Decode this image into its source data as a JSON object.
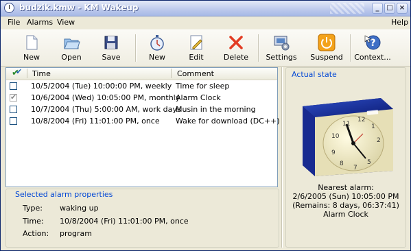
{
  "window": {
    "title": "budzik.kmw - KM Wakeup"
  },
  "menu": {
    "file": "File",
    "alarms": "Alarms",
    "view": "View",
    "help": "Help"
  },
  "toolbar": {
    "new1": "New",
    "open": "Open",
    "save": "Save",
    "new2": "New",
    "edit": "Edit",
    "delete": "Delete",
    "settings": "Settings",
    "suspend": "Suspend",
    "context": "Context..."
  },
  "list": {
    "col_time": "Time",
    "col_comment": "Comment",
    "rows": [
      {
        "time": "10/5/2004 (Tue) 10:00:00 PM, weekly",
        "comment": "Time for sleep"
      },
      {
        "time": "10/6/2004 (Wed) 10:05:00 PM, monthly",
        "comment": "Alarm Clock"
      },
      {
        "time": "10/7/2004 (Thu) 5:00:00 AM, work days",
        "comment": "Musin in the morning"
      },
      {
        "time": "10/8/2004 (Fri) 11:01:00 PM, once",
        "comment": "Wake for download (DC++)"
      }
    ]
  },
  "props": {
    "title": "Selected alarm properties",
    "type_label": "Type:",
    "type_value": "waking up",
    "time_label": "Time:",
    "time_value": "10/8/2004 (Fri) 11:01:00 PM, once",
    "action_label": "Action:",
    "action_value": "program"
  },
  "state": {
    "title": "Actual state",
    "nearest_label": "Nearest alarm:",
    "nearest_time": "2/6/2005 (Sun) 10:05:00 PM",
    "remains": "(Remains: 8 days, 06:37:41)",
    "comment": "Alarm Clock"
  }
}
